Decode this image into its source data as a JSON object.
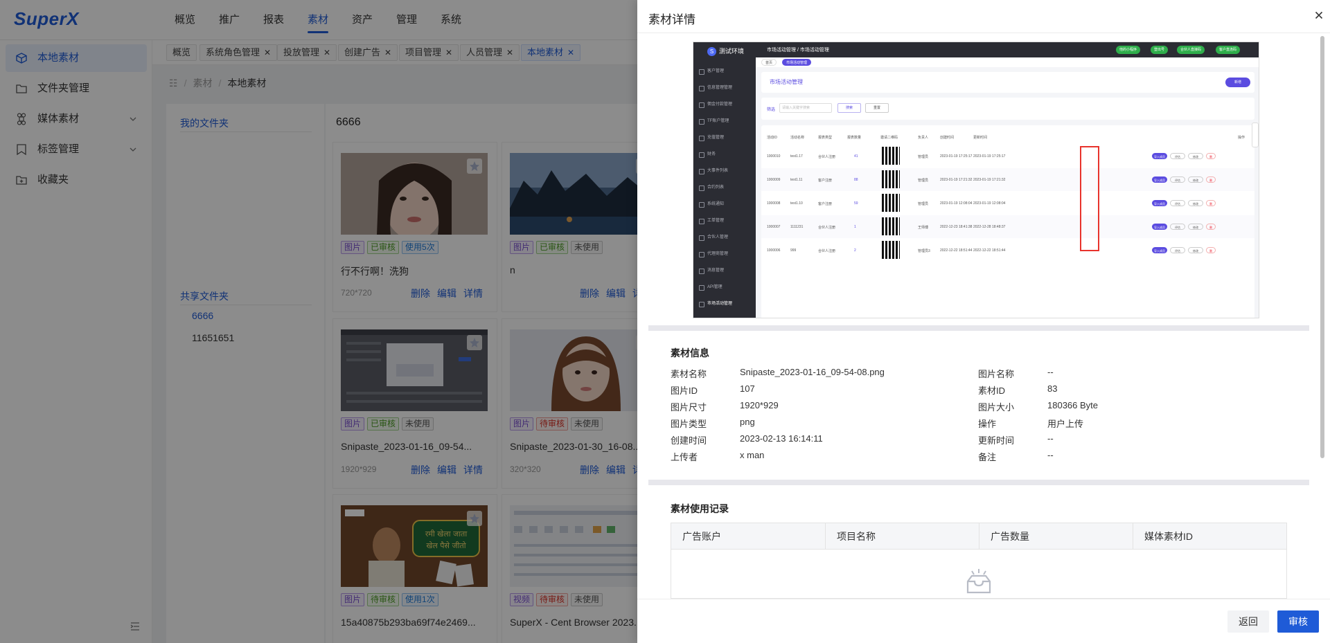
{
  "app": {
    "logo": "SuperX"
  },
  "top_nav": [
    "概览",
    "推广",
    "报表",
    "素材",
    "资产",
    "管理",
    "系统"
  ],
  "top_nav_active": "素材",
  "sidebar": {
    "items": [
      {
        "label": "本地素材",
        "icon": "cube-icon",
        "active": true
      },
      {
        "label": "文件夹管理",
        "icon": "folder-icon"
      },
      {
        "label": "媒体素材",
        "icon": "command-icon",
        "expandable": true
      },
      {
        "label": "标签管理",
        "icon": "bookmark-icon",
        "expandable": true
      },
      {
        "label": "收藏夹",
        "icon": "folder-plus-icon"
      }
    ]
  },
  "tabs": [
    {
      "label": "概览",
      "closable": false
    },
    {
      "label": "系统角色管理",
      "closable": true
    },
    {
      "label": "投放管理",
      "closable": true
    },
    {
      "label": "创建广告",
      "closable": true
    },
    {
      "label": "项目管理",
      "closable": true
    },
    {
      "label": "人员管理",
      "closable": true
    },
    {
      "label": "本地素材",
      "closable": true,
      "active": true
    }
  ],
  "breadcrumb": {
    "home_icon": "grid-icon",
    "items": [
      "素材",
      "本地素材"
    ]
  },
  "folders": {
    "my_title": "我的文件夹",
    "shared_title": "共享文件夹",
    "shared_items": [
      "6666",
      "11651651"
    ],
    "active": "6666"
  },
  "grid": {
    "title": "6666",
    "actions": {
      "delete": "删除",
      "edit": "编辑",
      "detail": "详情"
    },
    "cards": [
      {
        "tags": [
          "图片",
          "已审核",
          "使用5次"
        ],
        "name": "行不行啊！洗狗",
        "size": "720*720"
      },
      {
        "tags": [
          "图片",
          "已审核",
          "未使用"
        ],
        "name": "n",
        "size": ""
      },
      {
        "tags": [
          "图片",
          "已审核",
          "未使用"
        ],
        "name": "Snipaste_2023-01-16_09-54...",
        "size": "1920*929"
      },
      {
        "tags": [
          "图片",
          "待审核",
          "未使用"
        ],
        "name": "Snipaste_2023-01-30_16-08...",
        "size": "320*320"
      },
      {
        "tags": [
          "图片",
          "待审核",
          "使用1次"
        ],
        "name": "15a40875b293ba69f74e2469...",
        "size": ""
      },
      {
        "tags": [
          "视频",
          "待审核",
          "未使用"
        ],
        "name": "SuperX - Cent Browser 2023...",
        "size": ""
      }
    ],
    "thumb3": {
      "overlay_text": "रमी खेला जाता\nखेल पैसे जीतो"
    }
  },
  "drawer": {
    "title": "素材详情",
    "close_icon": "close-icon",
    "info_section": "素材信息",
    "info_left": [
      {
        "k": "素材名称",
        "v": "Snipaste_2023-01-16_09-54-08.png"
      },
      {
        "k": "图片ID",
        "v": "107"
      },
      {
        "k": "图片尺寸",
        "v": "1920*929"
      },
      {
        "k": "图片类型",
        "v": "png"
      },
      {
        "k": "创建时间",
        "v": "2023-02-13 16:14:11"
      },
      {
        "k": "上传者",
        "v": "x man"
      }
    ],
    "info_right": [
      {
        "k": "图片名称",
        "v": "--"
      },
      {
        "k": "素材ID",
        "v": "83"
      },
      {
        "k": "图片大小",
        "v": "180366 Byte"
      },
      {
        "k": "操作",
        "v": "用户上传"
      },
      {
        "k": "更新时间",
        "v": "--"
      },
      {
        "k": "备注",
        "v": "--"
      }
    ],
    "usage_section": "素材使用记录",
    "usage_columns": [
      "广告账户",
      "项目名称",
      "广告数量",
      "媒体素材ID"
    ],
    "empty_icon": "empty-inbox-icon",
    "footer": {
      "back": "返回",
      "review": "审核"
    }
  },
  "preview": {
    "logo": "测试环境",
    "crumb": "市场活动管理 / 市场活动管理",
    "top_pills": [
      "他的小程序",
      "登出号",
      "合伙人直接码",
      "客户直连码"
    ],
    "tabs": [
      "首页",
      "市场活动管理"
    ],
    "menu": [
      "客户管理",
      "信息管理管理",
      "佣金付款管理",
      "TF账户管理",
      "充值管理",
      "财务",
      "大事件列表",
      "合约列表",
      "系统通知",
      "工单管理",
      "合伙人管理",
      "代理商管理",
      "消息管理",
      "API管理",
      "市场活动管理"
    ],
    "page_title": "市场活动管理",
    "add_btn": "新增",
    "filter_label": "筛选",
    "filter_placeholder": "请输入关键字搜索",
    "search_btn": "搜索",
    "reset_btn": "重置",
    "columns": [
      "活动ID",
      "活动名称",
      "报表类型",
      "报表数量",
      "邀请二维码",
      "负责人",
      "创建时间",
      "更新时间",
      "操作"
    ],
    "rows": [
      {
        "id": "1000010",
        "name": "test1.17",
        "type": "合伙人注册",
        "count": "41",
        "owner": "管理员",
        "created": "2023-01-19 17:25:17",
        "updated": "2023-01-19 17:25:17"
      },
      {
        "id": "1000009",
        "name": "test1.11",
        "type": "客户注册",
        "count": "88",
        "owner": "管理员",
        "created": "2023-01-19 17:21:32",
        "updated": "2023-01-19 17:21:32"
      },
      {
        "id": "1000008",
        "name": "test1.10",
        "type": "客户注册",
        "count": "59",
        "owner": "管理员",
        "created": "2023-01-19 12:08:04",
        "updated": "2023-01-19 12:08:04"
      },
      {
        "id": "1000007",
        "name": "1111231",
        "type": "合伙人注册",
        "count": "1",
        "owner": "王师傅",
        "created": "2022-12-23 18:41:38",
        "updated": "2022-12-28 18:48:37"
      },
      {
        "id": "1000006",
        "name": "999",
        "type": "合伙人注册",
        "count": "2",
        "owner": "管理员3",
        "created": "2022-12-22 18:51:44",
        "updated": "2022-12-22 18:51:44"
      }
    ],
    "row_actions": [
      "导入成员",
      "评估",
      "修改",
      "删"
    ]
  }
}
